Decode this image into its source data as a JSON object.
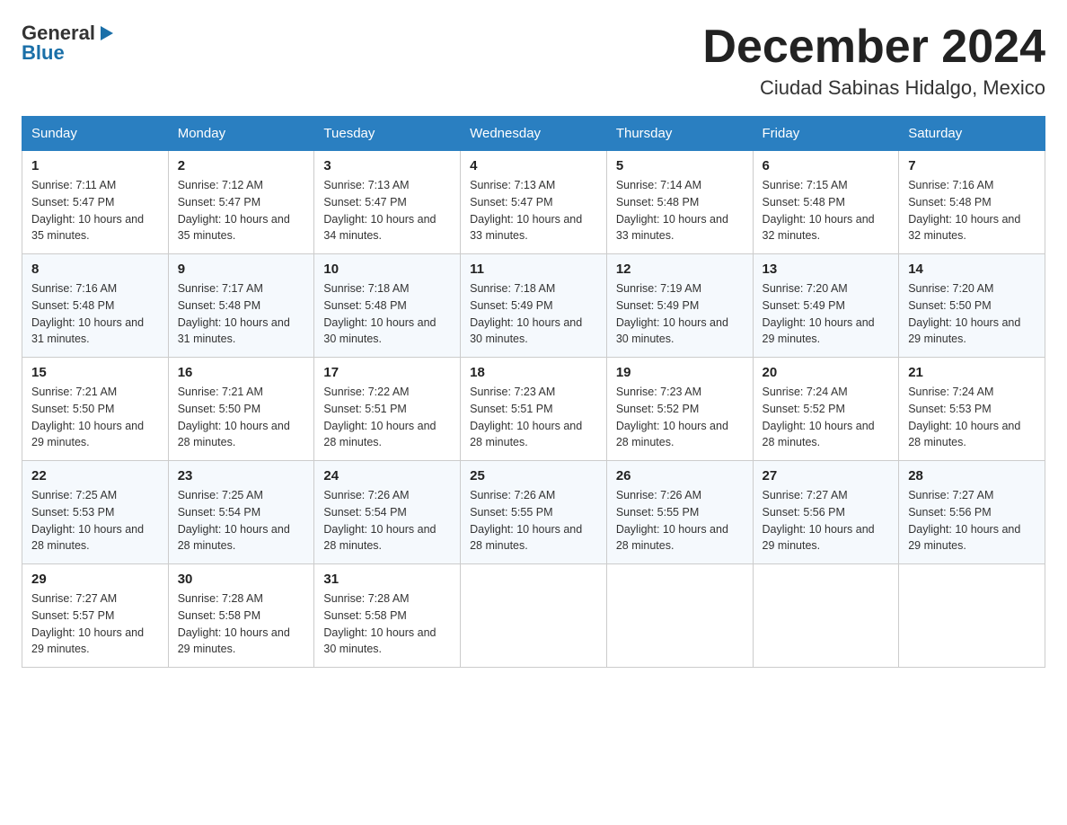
{
  "header": {
    "logo_general": "General",
    "logo_blue": "Blue",
    "month_title": "December 2024",
    "location": "Ciudad Sabinas Hidalgo, Mexico"
  },
  "days_of_week": [
    "Sunday",
    "Monday",
    "Tuesday",
    "Wednesday",
    "Thursday",
    "Friday",
    "Saturday"
  ],
  "weeks": [
    [
      {
        "day": "1",
        "sunrise": "7:11 AM",
        "sunset": "5:47 PM",
        "daylight": "10 hours and 35 minutes."
      },
      {
        "day": "2",
        "sunrise": "7:12 AM",
        "sunset": "5:47 PM",
        "daylight": "10 hours and 35 minutes."
      },
      {
        "day": "3",
        "sunrise": "7:13 AM",
        "sunset": "5:47 PM",
        "daylight": "10 hours and 34 minutes."
      },
      {
        "day": "4",
        "sunrise": "7:13 AM",
        "sunset": "5:47 PM",
        "daylight": "10 hours and 33 minutes."
      },
      {
        "day": "5",
        "sunrise": "7:14 AM",
        "sunset": "5:48 PM",
        "daylight": "10 hours and 33 minutes."
      },
      {
        "day": "6",
        "sunrise": "7:15 AM",
        "sunset": "5:48 PM",
        "daylight": "10 hours and 32 minutes."
      },
      {
        "day": "7",
        "sunrise": "7:16 AM",
        "sunset": "5:48 PM",
        "daylight": "10 hours and 32 minutes."
      }
    ],
    [
      {
        "day": "8",
        "sunrise": "7:16 AM",
        "sunset": "5:48 PM",
        "daylight": "10 hours and 31 minutes."
      },
      {
        "day": "9",
        "sunrise": "7:17 AM",
        "sunset": "5:48 PM",
        "daylight": "10 hours and 31 minutes."
      },
      {
        "day": "10",
        "sunrise": "7:18 AM",
        "sunset": "5:48 PM",
        "daylight": "10 hours and 30 minutes."
      },
      {
        "day": "11",
        "sunrise": "7:18 AM",
        "sunset": "5:49 PM",
        "daylight": "10 hours and 30 minutes."
      },
      {
        "day": "12",
        "sunrise": "7:19 AM",
        "sunset": "5:49 PM",
        "daylight": "10 hours and 30 minutes."
      },
      {
        "day": "13",
        "sunrise": "7:20 AM",
        "sunset": "5:49 PM",
        "daylight": "10 hours and 29 minutes."
      },
      {
        "day": "14",
        "sunrise": "7:20 AM",
        "sunset": "5:50 PM",
        "daylight": "10 hours and 29 minutes."
      }
    ],
    [
      {
        "day": "15",
        "sunrise": "7:21 AM",
        "sunset": "5:50 PM",
        "daylight": "10 hours and 29 minutes."
      },
      {
        "day": "16",
        "sunrise": "7:21 AM",
        "sunset": "5:50 PM",
        "daylight": "10 hours and 28 minutes."
      },
      {
        "day": "17",
        "sunrise": "7:22 AM",
        "sunset": "5:51 PM",
        "daylight": "10 hours and 28 minutes."
      },
      {
        "day": "18",
        "sunrise": "7:23 AM",
        "sunset": "5:51 PM",
        "daylight": "10 hours and 28 minutes."
      },
      {
        "day": "19",
        "sunrise": "7:23 AM",
        "sunset": "5:52 PM",
        "daylight": "10 hours and 28 minutes."
      },
      {
        "day": "20",
        "sunrise": "7:24 AM",
        "sunset": "5:52 PM",
        "daylight": "10 hours and 28 minutes."
      },
      {
        "day": "21",
        "sunrise": "7:24 AM",
        "sunset": "5:53 PM",
        "daylight": "10 hours and 28 minutes."
      }
    ],
    [
      {
        "day": "22",
        "sunrise": "7:25 AM",
        "sunset": "5:53 PM",
        "daylight": "10 hours and 28 minutes."
      },
      {
        "day": "23",
        "sunrise": "7:25 AM",
        "sunset": "5:54 PM",
        "daylight": "10 hours and 28 minutes."
      },
      {
        "day": "24",
        "sunrise": "7:26 AM",
        "sunset": "5:54 PM",
        "daylight": "10 hours and 28 minutes."
      },
      {
        "day": "25",
        "sunrise": "7:26 AM",
        "sunset": "5:55 PM",
        "daylight": "10 hours and 28 minutes."
      },
      {
        "day": "26",
        "sunrise": "7:26 AM",
        "sunset": "5:55 PM",
        "daylight": "10 hours and 28 minutes."
      },
      {
        "day": "27",
        "sunrise": "7:27 AM",
        "sunset": "5:56 PM",
        "daylight": "10 hours and 29 minutes."
      },
      {
        "day": "28",
        "sunrise": "7:27 AM",
        "sunset": "5:56 PM",
        "daylight": "10 hours and 29 minutes."
      }
    ],
    [
      {
        "day": "29",
        "sunrise": "7:27 AM",
        "sunset": "5:57 PM",
        "daylight": "10 hours and 29 minutes."
      },
      {
        "day": "30",
        "sunrise": "7:28 AM",
        "sunset": "5:58 PM",
        "daylight": "10 hours and 29 minutes."
      },
      {
        "day": "31",
        "sunrise": "7:28 AM",
        "sunset": "5:58 PM",
        "daylight": "10 hours and 30 minutes."
      },
      null,
      null,
      null,
      null
    ]
  ],
  "labels": {
    "sunrise_prefix": "Sunrise: ",
    "sunset_prefix": "Sunset: ",
    "daylight_prefix": "Daylight: "
  }
}
